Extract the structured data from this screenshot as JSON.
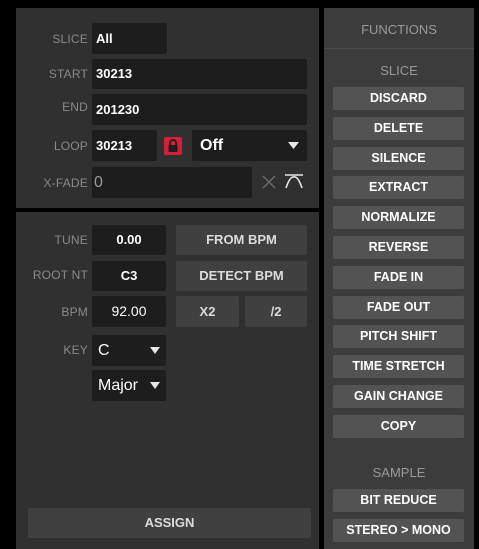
{
  "slice_panel": {
    "slice": {
      "label": "SLICE",
      "value": "All"
    },
    "start": {
      "label": "START",
      "value": "30213"
    },
    "end": {
      "label": "END",
      "value": "201230"
    },
    "loop": {
      "label": "LOOP",
      "value": "30213",
      "mode": "Off"
    },
    "xfade": {
      "label": "X-FADE",
      "value": "0"
    }
  },
  "tune_panel": {
    "tune": {
      "label": "TUNE",
      "value": "0.00"
    },
    "root": {
      "label": "ROOT NT",
      "value": "C3"
    },
    "bpm": {
      "label": "BPM",
      "value": "92.00"
    },
    "key": {
      "label": "KEY",
      "value": "C",
      "scale": "Major"
    },
    "from_bpm": "FROM BPM",
    "detect_bpm": "DETECT BPM",
    "x2": "X2",
    "half": "/2",
    "assign": "ASSIGN"
  },
  "functions": {
    "title": "FUNCTIONS",
    "slice_header": "SLICE",
    "slice_buttons": [
      "DISCARD",
      "DELETE",
      "SILENCE",
      "EXTRACT",
      "NORMALIZE",
      "REVERSE",
      "FADE IN",
      "FADE OUT",
      "PITCH SHIFT",
      "TIME STRETCH",
      "GAIN CHANGE",
      "COPY"
    ],
    "sample_header": "SAMPLE",
    "sample_buttons": [
      "BIT REDUCE",
      "STEREO > MONO"
    ]
  },
  "colors": {
    "accent_red": "#d41f3b",
    "panel": "#303030",
    "field": "#1d1d1d",
    "function_button": "#535353"
  }
}
